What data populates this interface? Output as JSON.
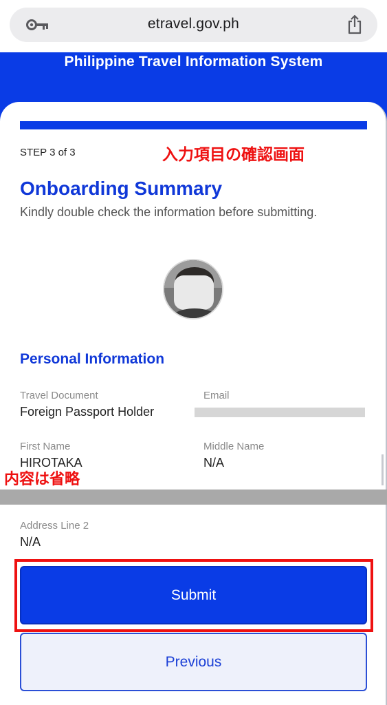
{
  "browser": {
    "url": "etravel.gov.ph"
  },
  "header": {
    "title": "Philippine Travel Information System"
  },
  "step": {
    "label": "STEP 3 of 3",
    "progress": 1.0
  },
  "annotations": {
    "top_note": "入力項目の確認画面",
    "middle_note": "内容は省略"
  },
  "summary": {
    "title": "Onboarding Summary",
    "subtitle": "Kindly double check the information before submitting."
  },
  "personal_info": {
    "section_title": "Personal Information",
    "fields": [
      {
        "label": "Travel Document",
        "value": "Foreign Passport Holder"
      },
      {
        "label": "Email",
        "value": ""
      },
      {
        "label": "First Name",
        "value": "HIROTAKA"
      },
      {
        "label": "Middle Name",
        "value": "N/A"
      },
      {
        "label": "Address Line 2",
        "value": "N/A"
      }
    ]
  },
  "actions": {
    "submit_label": "Submit",
    "previous_label": "Previous"
  },
  "colors": {
    "brand_blue": "#0a3ce6",
    "annotation_red": "#ee1111"
  },
  "icons": {
    "url_left": "key-icon",
    "url_right": "share-icon"
  }
}
